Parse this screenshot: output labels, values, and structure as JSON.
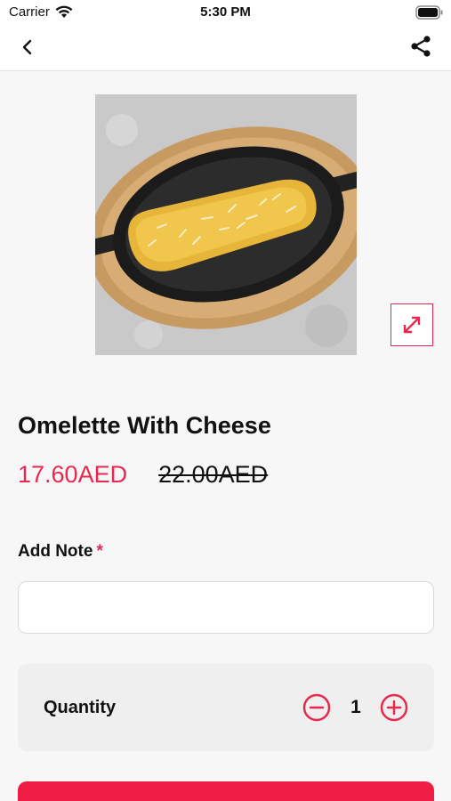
{
  "status_bar": {
    "carrier": "Carrier",
    "time": "5:30 PM",
    "icons": [
      "wifi-icon",
      "battery-icon"
    ]
  },
  "nav": {
    "back_icon": "chevron-left-icon",
    "share_icon": "share-icon"
  },
  "product": {
    "image_description_icon": "omelette-photo",
    "expand_icon": "expand-arrows-icon",
    "title": "Omelette With Cheese",
    "price_current": "17.60AED",
    "price_old": "22.00AED"
  },
  "note": {
    "label": "Add Note",
    "required_mark": "*",
    "value": "",
    "placeholder": ""
  },
  "quantity": {
    "label": "Quantity",
    "value": "1",
    "minus_icon": "minus-circle-icon",
    "plus_icon": "plus-circle-icon"
  },
  "colors": {
    "accent": "#e8294f",
    "button": "#ef1d45"
  }
}
